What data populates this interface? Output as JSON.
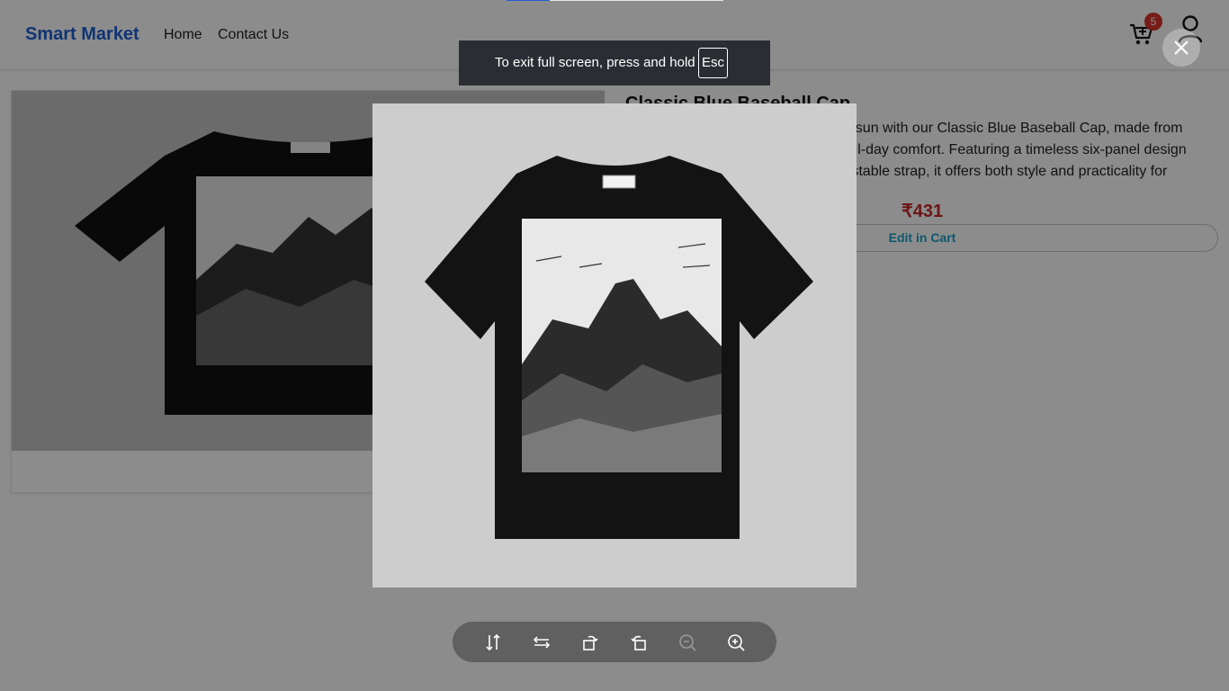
{
  "navbar": {
    "brand": "Smart Market",
    "links": [
      "Home",
      "Contact Us"
    ],
    "cart_icon": "cart-icon",
    "cart_count": "5",
    "user_icon": "user-icon"
  },
  "product": {
    "title": "Classic Blue Baseball Cap",
    "description": "Stay stylish and protected from the sun with our Classic Blue Baseball Cap, made from high-quality, breathable cotton for all-day comfort. Featuring a timeless six-panel design with a pre-curved brim and an adjustable strap, it offers both style and practicality for everyday wear.",
    "price": "₹431",
    "cart_button": "Edit in Cart"
  },
  "image_preview": {
    "fullscreen_notice": "To exit full screen, press and hold",
    "fullscreen_key": "Esc",
    "close_icon": "close-icon",
    "slide_progress": 0.2,
    "tools": [
      "flip-vertical-icon",
      "flip-horizontal-icon",
      "rotate-left-icon",
      "rotate-right-icon",
      "zoom-out-icon",
      "zoom-in-icon"
    ]
  },
  "colors": {
    "brand": "#1d5fd6",
    "price": "#c62828",
    "badge": "#d9342b",
    "cart_button_text": "#1aa0c8"
  }
}
